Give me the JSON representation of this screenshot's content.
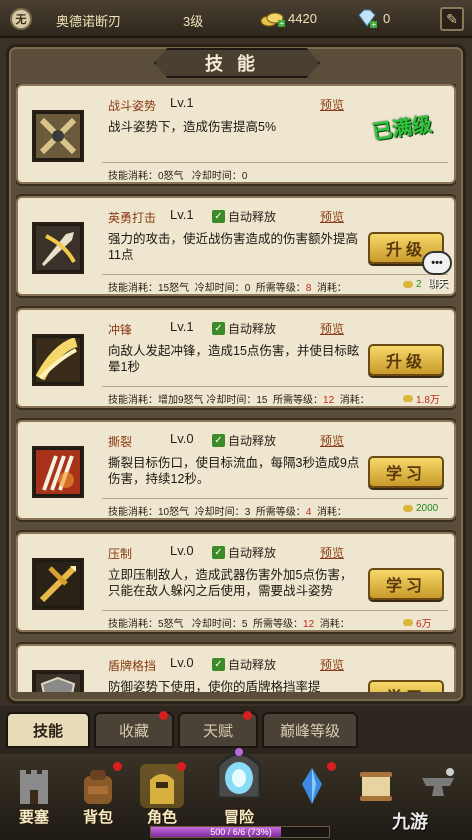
{
  "topbar": {
    "emblem": "无",
    "player_name": "奥德诺断刃",
    "level": "3级",
    "gold": "4420",
    "diamond": "0"
  },
  "panel": {
    "title": "技能"
  },
  "skills": [
    {
      "name": "战斗姿势",
      "lv": "Lv.1",
      "auto": "",
      "preview": "预览",
      "desc": "战斗姿势下，造成伤害提高5%",
      "foot": {
        "cost_label": "技能消耗：",
        "cost": "0怒气",
        "cd_label": "冷却时间：",
        "cd": "0"
      },
      "maxed": "已满级"
    },
    {
      "name": "英勇打击",
      "lv": "Lv.1",
      "auto": "自动释放",
      "preview": "预览",
      "desc": "强力的攻击，使近战伤害造成的伤害额外提高11点",
      "foot": {
        "cost_label": "技能消耗：",
        "cost": "15怒气",
        "cd_label": "冷却时间：",
        "cd": "0",
        "req_label": "所需等级：",
        "req": "8",
        "price_label": "消耗：",
        "price": "2"
      },
      "action": "升级"
    },
    {
      "name": "冲锋",
      "lv": "Lv.1",
      "auto": "自动释放",
      "preview": "预览",
      "desc": "向敌人发起冲锋，造成15点伤害，并使目标眩晕1秒",
      "foot": {
        "cost_label": "技能消耗：",
        "cost": "增加9怒气",
        "cd_label": "冷却时间：",
        "cd": "15",
        "req_label": "所需等级：",
        "req": "12",
        "price_label": "消耗：",
        "price": "1.8万"
      },
      "action": "升级"
    },
    {
      "name": "撕裂",
      "lv": "Lv.0",
      "auto": "自动释放",
      "preview": "预览",
      "desc": "撕裂目标伤口，使目标流血，每隔3秒造成9点伤害，持续12秒。",
      "foot": {
        "cost_label": "技能消耗：",
        "cost": "10怒气",
        "cd_label": "冷却时间：",
        "cd": "3",
        "req_label": "所需等级：",
        "req": "4",
        "price_label": "消耗：",
        "price": "2000"
      },
      "action": "学习"
    },
    {
      "name": "压制",
      "lv": "Lv.0",
      "auto": "自动释放",
      "preview": "预览",
      "desc": "立即压制敌人，造成武器伤害外加5点伤害，只能在敌人躲闪之后使用，需要战斗姿势",
      "foot": {
        "cost_label": "技能消耗：",
        "cost": "5怒气",
        "cd_label": "冷却时间：",
        "cd": "5",
        "req_label": "所需等级：",
        "req": "12",
        "price_label": "消耗：",
        "price": "6万"
      },
      "action": "学习"
    },
    {
      "name": "盾牌格挡",
      "lv": "Lv.0",
      "auto": "自动释放",
      "preview": "预览",
      "desc": "防御姿势下使用，使你的盾牌格挡率提",
      "action": "学习"
    }
  ],
  "chat": {
    "label": "聊天",
    "bubble": "•••"
  },
  "tabs": [
    {
      "label": "技能",
      "active": true
    },
    {
      "label": "收藏",
      "dot": true
    },
    {
      "label": "天赋",
      "dot": true
    },
    {
      "label": "巅峰等级"
    }
  ],
  "nav": [
    {
      "label": "要塞",
      "icon": "fortress-icon"
    },
    {
      "label": "背包",
      "icon": "backpack-icon",
      "dot": true
    },
    {
      "label": "角色",
      "icon": "character-icon",
      "dot": true
    },
    {
      "label": "冒险",
      "icon": "portal-icon"
    },
    {
      "label": "",
      "icon": "crystal-icon",
      "dot": true
    },
    {
      "label": "",
      "icon": "scroll-icon"
    },
    {
      "label": "",
      "icon": "anvil-icon"
    }
  ],
  "xp": {
    "text": "500 / 6/6 (73%)",
    "fraction": 0.73
  },
  "watermark": "九游",
  "colors": {
    "maxed": "#2ec43c",
    "skill_name": "#8a3a12",
    "accent_gold": "#d9b53a",
    "req_red": "#c2281c"
  }
}
